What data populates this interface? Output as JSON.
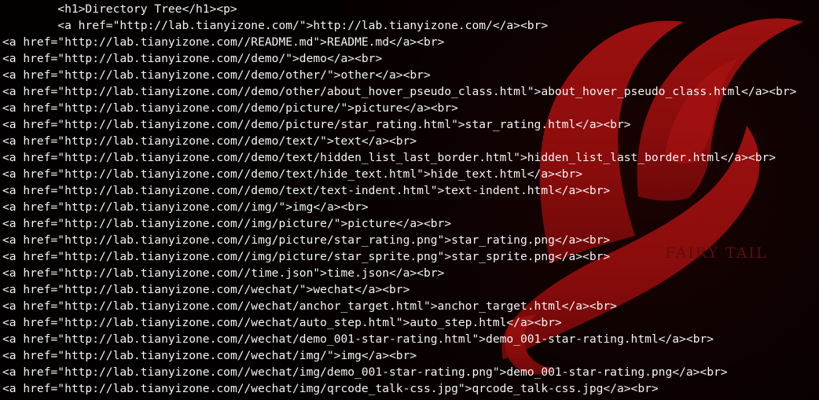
{
  "terminal": {
    "lines": [
      "        <h1>Directory Tree</h1><p>",
      "        <a href=\"http://lab.tianyizone.com/\">http://lab.tianyizone.com/</a><br>",
      "<a href=\"http://lab.tianyizone.com//README.md\">README.md</a><br>",
      "<a href=\"http://lab.tianyizone.com//demo/\">demo</a><br>",
      "<a href=\"http://lab.tianyizone.com//demo/other/\">other</a><br>",
      "<a href=\"http://lab.tianyizone.com//demo/other/about_hover_pseudo_class.html\">about_hover_pseudo_class.html</a><br>",
      "<a href=\"http://lab.tianyizone.com//demo/picture/\">picture</a><br>",
      "<a href=\"http://lab.tianyizone.com//demo/picture/star_rating.html\">star_rating.html</a><br>",
      "<a href=\"http://lab.tianyizone.com//demo/text/\">text</a><br>",
      "<a href=\"http://lab.tianyizone.com//demo/text/hidden_list_last_border.html\">hidden_list_last_border.html</a><br>",
      "<a href=\"http://lab.tianyizone.com//demo/text/hide_text.html\">hide_text.html</a><br>",
      "<a href=\"http://lab.tianyizone.com//demo/text/text-indent.html\">text-indent.html</a><br>",
      "<a href=\"http://lab.tianyizone.com//img/\">img</a><br>",
      "<a href=\"http://lab.tianyizone.com//img/picture/\">picture</a><br>",
      "<a href=\"http://lab.tianyizone.com//img/picture/star_rating.png\">star_rating.png</a><br>",
      "<a href=\"http://lab.tianyizone.com//img/picture/star_sprite.png\">star_sprite.png</a><br>",
      "<a href=\"http://lab.tianyizone.com//time.json\">time.json</a><br>",
      "<a href=\"http://lab.tianyizone.com//wechat/\">wechat</a><br>",
      "<a href=\"http://lab.tianyizone.com//wechat/anchor_target.html\">anchor_target.html</a><br>",
      "<a href=\"http://lab.tianyizone.com//wechat/auto_step.html\">auto_step.html</a><br>",
      "<a href=\"http://lab.tianyizone.com//wechat/demo_001-star-rating.html\">demo_001-star-rating.html</a><br>",
      "<a href=\"http://lab.tianyizone.com//wechat/img/\">img</a><br>",
      "<a href=\"http://lab.tianyizone.com//wechat/img/demo_001-star-rating.png\">demo_001-star-rating.png</a><br>",
      "<a href=\"http://lab.tianyizone.com//wechat/img/qrcode_talk-css.jpg\">qrcode_talk-css.jpg</a><br>"
    ],
    "text_color": "#f4f4f4",
    "background_color": "#050000"
  },
  "wallpaper": {
    "icon": "fairy-tail-emblem-icon",
    "caption": "FAIRY TAIL",
    "emblem_color": "#8e0c0c",
    "caption_color": "#5a0f0f"
  }
}
